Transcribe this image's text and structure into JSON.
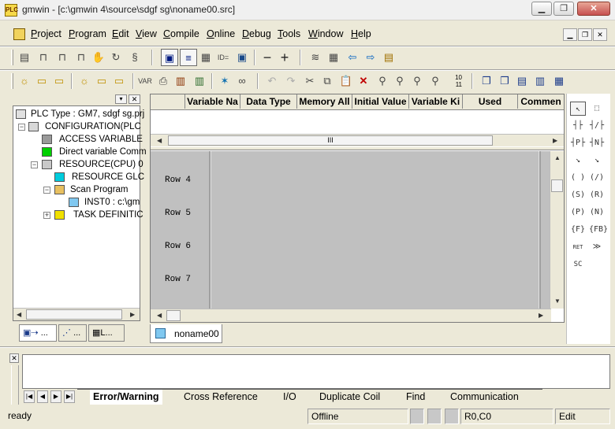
{
  "window": {
    "title": "gmwin - [c:\\gmwin 4\\source\\sdgf sg\\noname00.src]",
    "icon_text": "PLC"
  },
  "menu": [
    "Project",
    "Program",
    "Edit",
    "View",
    "Compile",
    "Online",
    "Debug",
    "Tools",
    "Window",
    "Help"
  ],
  "tree": {
    "root": "PLC Type : GM7, sdgf sg.prj",
    "configuration": "CONFIGURATION(PLC",
    "access_variable": "ACCESS VARIABLE",
    "direct_variable": "Direct variable Comm",
    "resource": "RESOURCE(CPU) 0",
    "resource_global": "RESOURCE GLC",
    "scan_program": "Scan Program",
    "inst0": "INST0 : c:\\gm",
    "task_definition": "TASK DEFINITIC"
  },
  "left_tabs": [
    "...",
    "...",
    "L..."
  ],
  "grid": {
    "columns": [
      "Variable Na",
      "Data Type",
      "Memory All",
      "Initial Value",
      "Variable Ki",
      "Used",
      "Commen"
    ],
    "hscroll_thumb": "III"
  },
  "ladder_rows": [
    "Row 4",
    "Row 5",
    "Row 6",
    "Row 7"
  ],
  "doc_tab": "noname00",
  "output_tabs": [
    "Error/Warning",
    "Cross Reference",
    "I/O",
    "Duplicate Coil",
    "Find",
    "Communication"
  ],
  "status": {
    "message": "ready",
    "online": "Offline",
    "position": "R0,C0",
    "mode": "Edit"
  },
  "palette": [
    "↖",
    "⬚",
    "┤├",
    "┤/├",
    "┤P├",
    "┤N├",
    "↘",
    "↘",
    "( )",
    "(/)",
    "(S)",
    "(R)",
    "(P)",
    "(N)",
    "{F}",
    "{FB}",
    "RET",
    "≫",
    "SC"
  ],
  "toolbar2_text": [
    "ID=",
    "10",
    "11"
  ]
}
